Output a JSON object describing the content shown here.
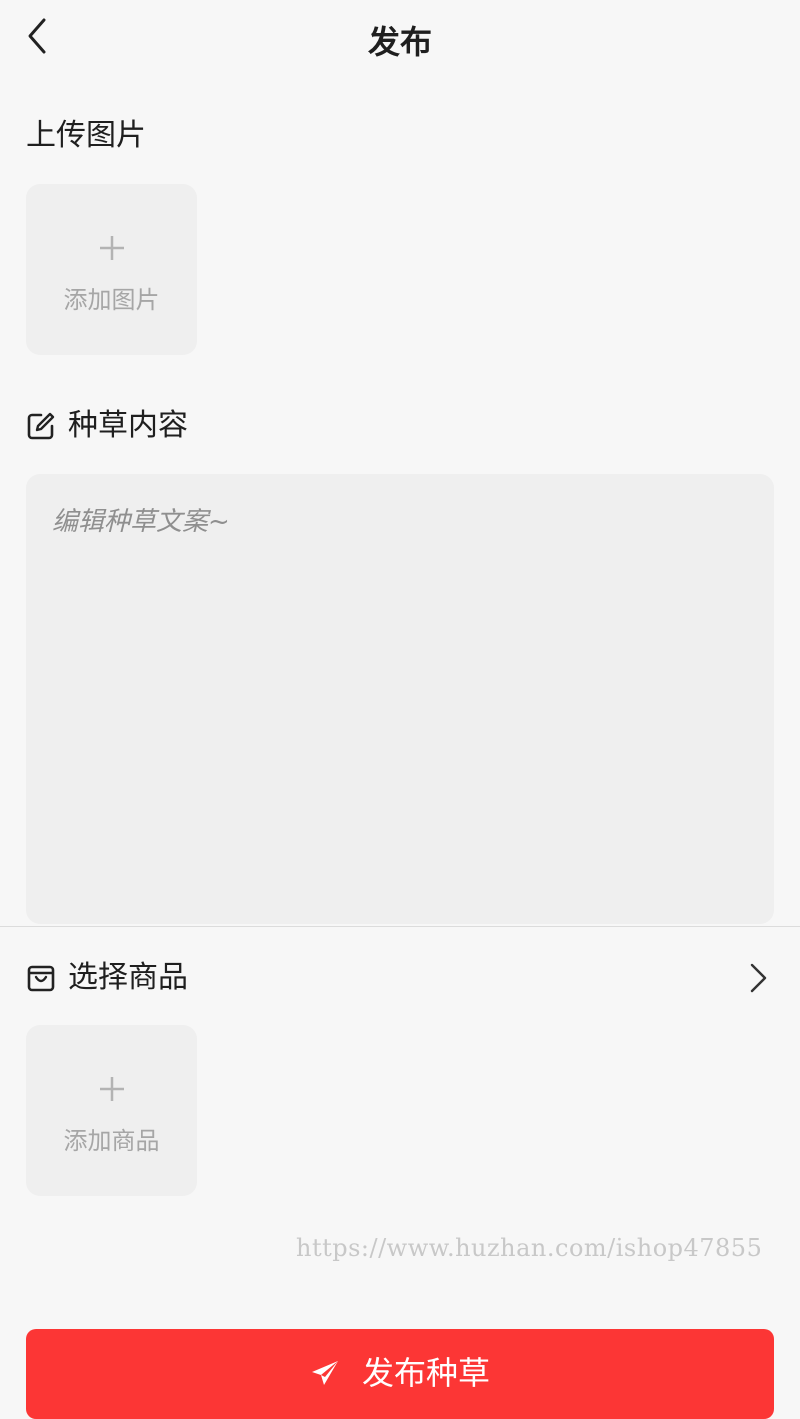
{
  "header": {
    "title": "发布",
    "back_icon": "chevron-left-icon"
  },
  "upload": {
    "title": "上传图片",
    "add_label": "添加图片",
    "add_icon": "plus-icon"
  },
  "content": {
    "title": "种草内容",
    "icon": "edit-icon",
    "placeholder": "编辑种草文案~"
  },
  "product": {
    "title": "选择商品",
    "icon": "shopping-bag-icon",
    "chevron_icon": "chevron-right-icon",
    "add_label": "添加商品",
    "add_icon": "plus-icon"
  },
  "watermark": "https://www.huzhan.com/ishop47855",
  "publish_button": {
    "label": "发布种草",
    "icon": "paper-plane-icon",
    "color": "#fc3635"
  },
  "colors": {
    "background": "#f7f7f7",
    "box_fill": "#efefef",
    "accent": "#fc3635"
  }
}
